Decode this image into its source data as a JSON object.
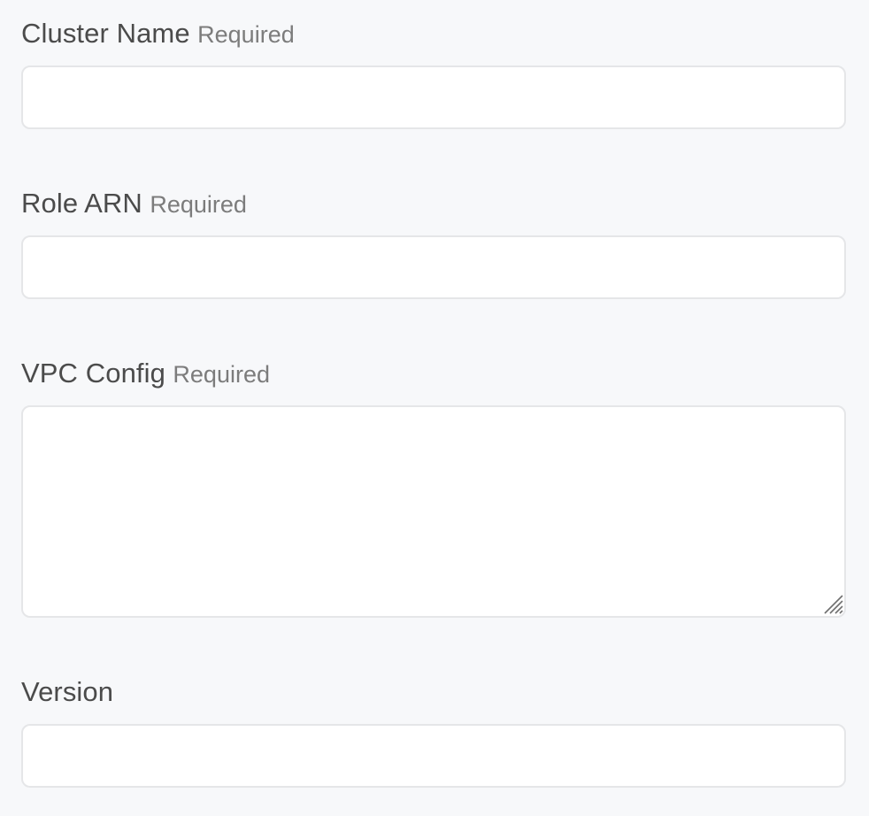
{
  "fields": [
    {
      "label": "Cluster Name",
      "required_text": "Required",
      "value": "",
      "placeholder": ""
    },
    {
      "label": "Role ARN",
      "required_text": "Required",
      "value": "",
      "placeholder": ""
    },
    {
      "label": "VPC Config",
      "required_text": "Required",
      "value": "",
      "placeholder": ""
    },
    {
      "label": "Version",
      "value": "",
      "placeholder": ""
    }
  ],
  "icons": {
    "textarea_resize": "resize-grip-icon"
  },
  "colors": {
    "page_background": "#f7f8fa",
    "field_background": "#ffffff",
    "field_border": "#e5e6e8",
    "label_text": "#4b4b4b",
    "required_text": "#7c7c7c"
  }
}
